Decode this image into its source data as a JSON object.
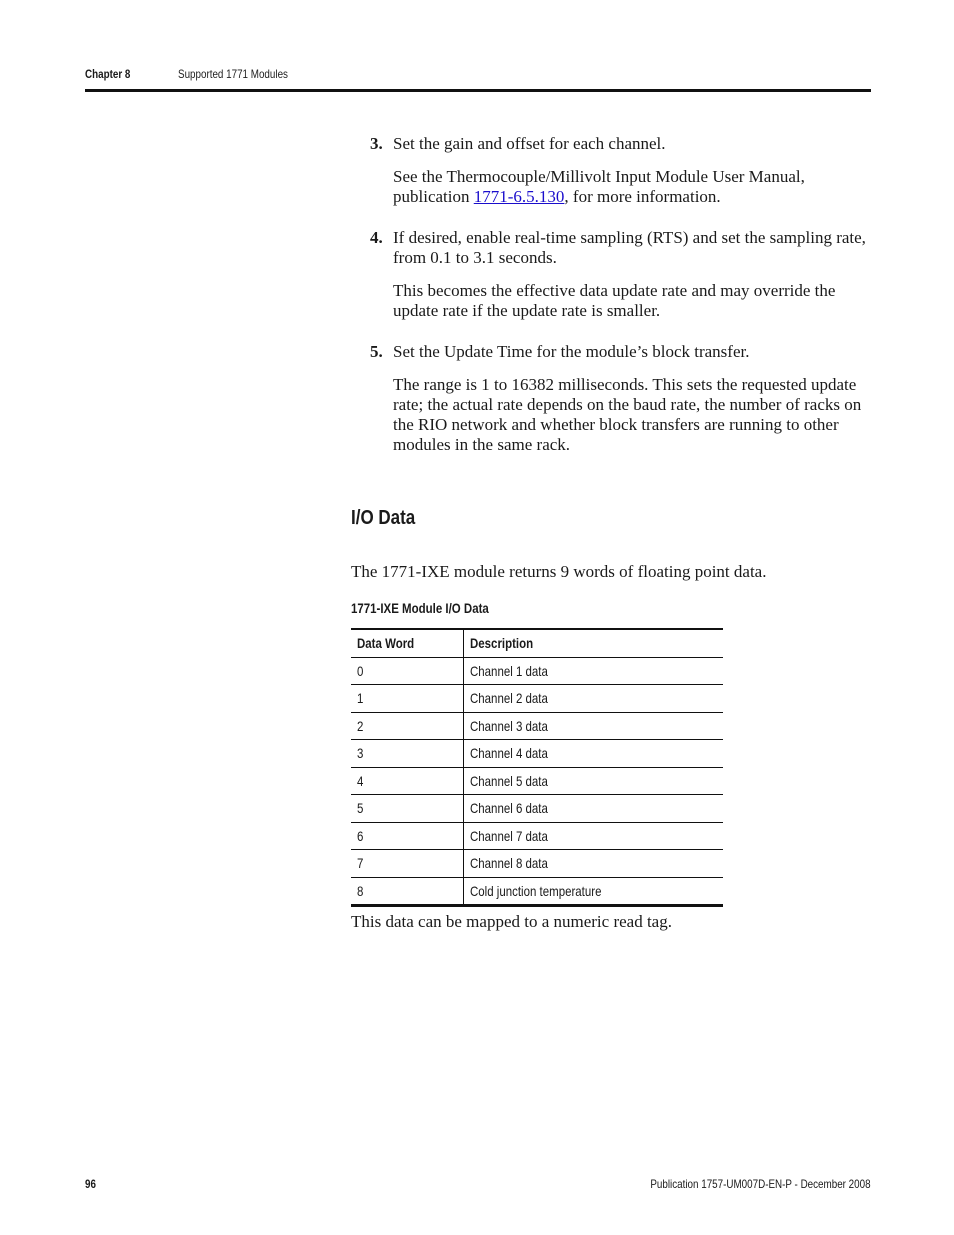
{
  "header": {
    "chapter": "Chapter 8",
    "title": "Supported 1771 Modules"
  },
  "steps": [
    {
      "number": "3.",
      "text": "Set the gain and offset for each channel.",
      "detail_before": "See the Thermocouple/Millivolt Input Module User Manual, publication ",
      "detail_link": "1771-6.5.130",
      "detail_after": ", for more information."
    },
    {
      "number": "4.",
      "text": "If desired, enable real-time sampling (RTS) and set the sampling rate, from 0.1 to 3.1 seconds.",
      "detail": "This becomes the effective data update rate and may override the update rate if the update rate is smaller."
    },
    {
      "number": "5.",
      "text": "Set the Update Time for the module’s block transfer.",
      "detail": "The range is 1 to 16382 milliseconds. This sets the requested update rate; the actual rate depends on the baud rate, the number of racks on the RIO network and whether block transfers are running to other modules in the same rack."
    }
  ],
  "section": {
    "title": "I/O Data",
    "intro": "The 1771-IXE module returns 9 words of floating point data.",
    "table_caption": "1771-IXE Module I/O Data",
    "table": {
      "headers": [
        "Data Word",
        "Description"
      ],
      "rows": [
        [
          "0",
          "Channel 1 data"
        ],
        [
          "1",
          "Channel 2 data"
        ],
        [
          "2",
          "Channel 3 data"
        ],
        [
          "3",
          "Channel 4 data"
        ],
        [
          "4",
          "Channel 5 data"
        ],
        [
          "5",
          "Channel 6 data"
        ],
        [
          "6",
          "Channel 7 data"
        ],
        [
          "7",
          "Channel 8 data"
        ],
        [
          "8",
          "Cold junction temperature"
        ]
      ]
    },
    "outro": "This data can be mapped to a numeric read tag."
  },
  "footer": {
    "page_number": "96",
    "publication": "Publication 1757-UM007D-EN-P - December 2008"
  },
  "colors": {
    "link": "#1a0dcc",
    "text": "#1a1a1a",
    "rule": "#111111"
  }
}
